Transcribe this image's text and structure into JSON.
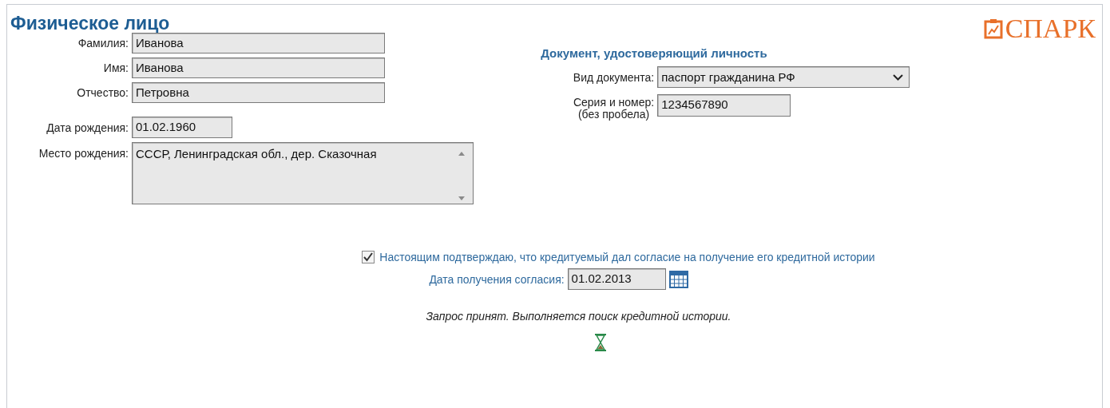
{
  "title": "Физическое лицо",
  "logo": {
    "text": "СПАРК"
  },
  "person_fields": [
    {
      "label": "Фамилия:",
      "value": "Иванова",
      "kind": "wide"
    },
    {
      "label": "Имя:",
      "value": "Иванова",
      "kind": "wide"
    },
    {
      "label": "Отчество:",
      "value": "Петровна",
      "kind": "wide"
    },
    {
      "label": "Дата рождения:",
      "value": "01.02.1960",
      "kind": "short"
    },
    {
      "label": "Место рождения:",
      "value": "СССР, Ленинградская обл., дер. Сказочная",
      "kind": "area"
    }
  ],
  "document": {
    "heading": "Документ, удостоверяющий личность",
    "type_label": "Вид документа:",
    "type_value": "паспорт гражданина РФ",
    "number_label": "Серия и номер:",
    "number_hint": "(без пробела)",
    "number_value": "1234567890"
  },
  "consent": {
    "checked": true,
    "text": "Настоящим подтверждаю, что кредитуемый дал согласие на получение его кредитной истории",
    "date_label": "Дата получения согласия:",
    "date_value": "01.02.2013"
  },
  "status_message": "Запрос принят. Выполняется поиск кредитной истории."
}
